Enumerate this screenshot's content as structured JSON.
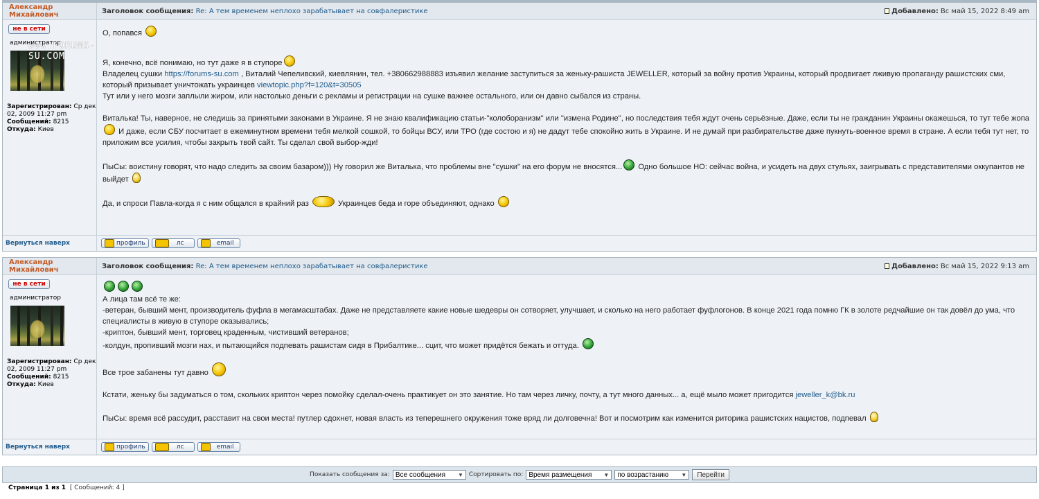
{
  "watermark": "www.FORUMS-SU.COM",
  "labels": {
    "subject_prefix": "Заголовок сообщения:",
    "posted_prefix": "Добавлено:",
    "online": "не в сети",
    "registered": "Зарегистрирован:",
    "posts": "Сообщений:",
    "from": "Откуда:",
    "back_to_top": "Вернуться наверх",
    "profile_btn": "профиль",
    "pm_btn": "лс",
    "email_btn": "email"
  },
  "posts": [
    {
      "author": "Александр Михайлович",
      "subject": "Re: А тем временем неплохо зарабатывает на совфалеристике",
      "posted": "Вс май 15, 2022 8:49 am",
      "rank": "администратор",
      "registered": "Ср дек 02, 2009 11:27 pm",
      "posts_count": "8215",
      "from": "Киев",
      "body": {
        "p1": "О, попався",
        "p2a": "Я, конечно, всё понимаю, но тут даже я в ступоре",
        "p3a": "Владелец сушки ",
        "p3link": "https://forums-su.com",
        "p3b": " , Виталий Чепеливский, киевлянин, тел. +380662988883 изъявил желание заступиться за женьку-рашиста JEWELLER, который за войну против Украины, который продвигает лживую пропаганду рашистских сми, который призывает уничтожать украинцев ",
        "p3link2": "viewtopic.php?f=120&t=30505",
        "p4": "Тут или у него мозги заплыли жиром, или настолько деньги с рекламы и регистрации на сушке важнее остального, или он давно сыбался из страны.",
        "p5a": "Виталька! Ты, наверное, не следишь за принятыми законами в Украине. Я не знаю квалификацию статьи-\"колоборанизм\" или \"измена Родине\", но последствия тебя ждут очень серьёзные. Даже, если ты не гражданин Украины окажешься, то тут тебе жопа",
        "p5b": " И даже, если СБУ посчитает в ежеминутном времени тебя мелкой сошкой, то бойцы ВСУ, или ТРО (где состою и я) не дадут тебе спокойно жить в Украине. И не думай при разбирательстве даже пукнуть-военное время в стране. А если тебя тут нет, то приложим все усилия, чтобы закрыть твой сайт. Ты сделал свой выбор-жди!",
        "p6a": "ПыСы: воистину говорят, что надо следить за своим базаром))) Ну говорил же Виталька, что проблемы вне \"сушки\" на его форум не вносятся...",
        "p6b": " Одно большое НО: сейчас война, и усидеть на двух стульях, заигрывать с представителями оккупантов не выйдет",
        "p7a": "Да, и спроси Павла-когда я с ним общался в крайний раз",
        "p7b": " Украинцев беда и горе объединяют, однако"
      }
    },
    {
      "author": "Александр Михайлович",
      "subject": "Re: А тем временем неплохо зарабатывает на совфалеристике",
      "posted": "Вс май 15, 2022 9:13 am",
      "rank": "администратор",
      "registered": "Ср дек 02, 2009 11:27 pm",
      "posts_count": "8215",
      "from": "Киев",
      "body": {
        "l1": "А лица там всё те же:",
        "l2": "-ветеран, бывший мент, производитель фуфла в мегамасштабах. Даже не представляете какие новые шедевры он сотворяет, улучшает, и сколько на него работает фуфлогонов. В конце 2021 года помню ГК в золоте редчайшие он так довёл до ума, что специалисты в живую в ступоре оказывались;",
        "l3": "-криптон, бывший мент, торговец краденным, чистивший ветеранов;",
        "l4": "-колдун, пропивший мозги нах, и пытающийся подпевать рашистам сидя в Прибалтике... сцит, что может придётся бежать и оттуда.",
        "l5": "Все трое забанены тут давно",
        "l6a": "Кстати, женьку бы задуматься о том, скольких криптон через помойку сделал-очень практикует он это занятие. Но там через личку, почту, а тут много данных... а, ещё мыло может пригодится ",
        "l6link": "jeweller_k@bk.ru",
        "l7": "ПыСы: время всё рассудит, расставит на свои места! путлер сдохнет, новая власть из теперешнего окружения тоже вряд ли долговечна! Вот и посмотрим как изменится риторика рашистских нацистов, подпевал"
      }
    }
  ],
  "sortbar": {
    "show_label": "Показать сообщения за:",
    "show_value": "Все сообщения",
    "sort_label": "Сортировать по:",
    "sort_value": "Время размещения",
    "order_value": "по возрастанию",
    "go_label": "Перейти"
  },
  "pagination": {
    "page_text": "Страница 1 из 1",
    "count_text": "[ Сообщений: 4 ]"
  },
  "icons": [
    "document-icon",
    "smiley-icon",
    "laughing-smiley-icon",
    "green-smiley-icon",
    "lightbulb-icon",
    "profile-icon",
    "pm-icon",
    "email-icon"
  ]
}
